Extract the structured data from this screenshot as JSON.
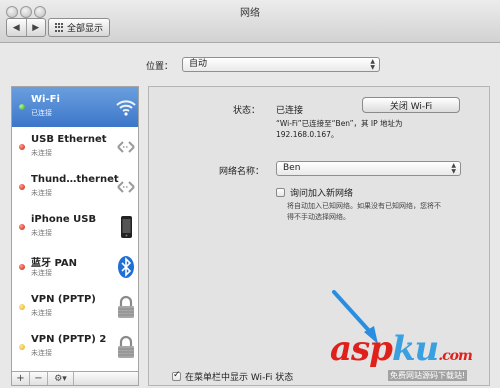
{
  "window": {
    "title": "网络"
  },
  "toolbar": {
    "back_label": "◀",
    "forward_label": "▶",
    "show_all_label": "全部显示"
  },
  "location": {
    "label": "位置：",
    "value": "自动"
  },
  "services": [
    {
      "name": "Wi-Fi",
      "status": "已连接",
      "dot": "green",
      "icon": "wifi-icon",
      "selected": true
    },
    {
      "name": "USB Ethernet",
      "status": "未连接",
      "dot": "red",
      "icon": "ethernet-arrows-icon"
    },
    {
      "name": "Thund…thernet",
      "status": "未连接",
      "dot": "red",
      "icon": "ethernet-arrows-icon"
    },
    {
      "name": "iPhone USB",
      "status": "未连接",
      "dot": "red",
      "icon": "iphone-icon"
    },
    {
      "name": "蓝牙 PAN",
      "status": "未连接",
      "dot": "red",
      "icon": "bluetooth-icon"
    },
    {
      "name": "VPN (PPTP)",
      "status": "未连接",
      "dot": "yellow",
      "icon": "lock-icon"
    },
    {
      "name": "VPN (PPTP) 2",
      "status": "未连接",
      "dot": "yellow",
      "icon": "lock-icon"
    }
  ],
  "sidebar_controls": {
    "add": "+",
    "remove": "−",
    "gear": "⚙▾"
  },
  "detail": {
    "status_label": "状态：",
    "status_value": "已连接",
    "turn_off_button": "关闭 Wi-Fi",
    "description_line1": "“Wi-Fi”已连接至“Ben”，其 IP 地址为",
    "description_line2": "192.168.0.167。",
    "network_name_label": "网络名称：",
    "network_name_value": "Ben",
    "ask_join_label": "询问加入新网络",
    "hint_line1": "将自动加入已知网络。如果没有已知网络，您将不",
    "hint_line2": "得不手动选择网络。",
    "show_in_menubar_label": "在菜单栏中显示 Wi-Fi 状态",
    "ask_join_checked": false,
    "show_in_menubar_checked": true
  },
  "watermark": {
    "brand_a": "asp",
    "brand_b": "ku",
    "brand_c": ".com",
    "subtitle": "免费网站源码下载站!"
  },
  "colors": {
    "selection": "#3c76c9",
    "wifi_connected": "#2fa31c",
    "disconnected": "#cc1d10",
    "vpn": "#e7ad0c"
  }
}
